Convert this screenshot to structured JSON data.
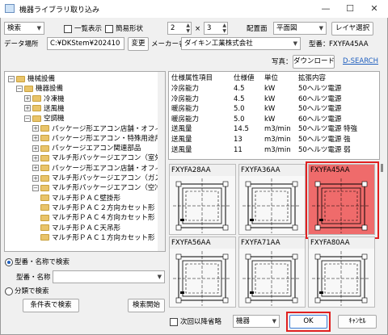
{
  "window": {
    "title": "機器ライブラリ取り込み",
    "minimize_glyph": "—",
    "maximize_glyph": "☐",
    "close_glyph": "✕"
  },
  "toolbar": {
    "search_mode": "検索",
    "list_view_label": "一覧表示",
    "simple_shape_label": "簡易形状",
    "cols_value": "2",
    "times_label": "×",
    "rows_value": "3",
    "layout_label": "配置面",
    "layout_value": "平面図",
    "layer_button": "レイヤ選択"
  },
  "datarow": {
    "data_location_label": "データ場所",
    "data_location_value": "C:¥DKStem¥202410",
    "change_button": "変更",
    "maker_label": "メーカー名",
    "maker_value": "ダイキン工業株式会社",
    "model_label": "型番：",
    "model_value": "FXYFA45AA"
  },
  "photo_row": {
    "photo_label": "写真：",
    "download_button": "ダウンロード",
    "dsearch_link": "D-SEARCH"
  },
  "tree": {
    "items": [
      {
        "indent": 0,
        "exp": "−",
        "icon": "folder",
        "label": "機械設備"
      },
      {
        "indent": 1,
        "exp": "−",
        "icon": "folder",
        "label": "機器設備"
      },
      {
        "indent": 2,
        "exp": "+",
        "icon": "folder",
        "label": "冷凍機"
      },
      {
        "indent": 2,
        "exp": "+",
        "icon": "folder",
        "label": "送風機"
      },
      {
        "indent": 2,
        "exp": "−",
        "icon": "folder",
        "label": "空調機"
      },
      {
        "indent": 3,
        "exp": "+",
        "icon": "folder",
        "label": "パッケージ形エアコン店舗・オフィス用（空"
      },
      {
        "indent": 3,
        "exp": "+",
        "icon": "folder",
        "label": "パッケージ形エアコン・特殊用途用"
      },
      {
        "indent": 3,
        "exp": "+",
        "icon": "folder",
        "label": "パッケージエアコン関連部品"
      },
      {
        "indent": 3,
        "exp": "+",
        "icon": "folder",
        "label": "マルチ形パッケージエアコン（室外機）"
      },
      {
        "indent": 3,
        "exp": "+",
        "icon": "folder",
        "label": "パッケージ形エアコン店舗・オフィス用（水"
      },
      {
        "indent": 3,
        "exp": "+",
        "icon": "folder",
        "label": "マルチ形パッケージエアコン（ガスＨＰ）"
      },
      {
        "indent": 3,
        "exp": "−",
        "icon": "folder",
        "label": "マルチ形パッケージエアコン（空冷ＨＰ）"
      },
      {
        "indent": 4,
        "exp": "",
        "icon": "folder",
        "label": "マルチ形ＰＡＣ壁掛形"
      },
      {
        "indent": 4,
        "exp": "",
        "icon": "folder",
        "label": "マルチ形ＰＡＣ２方向カセット形"
      },
      {
        "indent": 4,
        "exp": "",
        "icon": "folder",
        "label": "マルチ形ＰＡＣ４方向カセット形"
      },
      {
        "indent": 4,
        "exp": "",
        "icon": "folder",
        "label": "マルチ形ＰＡＣ天吊形"
      },
      {
        "indent": 4,
        "exp": "",
        "icon": "folder",
        "label": "マルチ形ＰＡＣ１方向カセット形"
      }
    ]
  },
  "search_panel": {
    "radio_name_label": "型番・名称で検索",
    "name_field_label": "型番・名称",
    "name_field_value": "",
    "radio_class_label": "分類で検索",
    "condition_button": "条件表で検索",
    "search_start_button": "検索開始"
  },
  "spec_table": {
    "headers": [
      "仕様属性項目",
      "仕様値",
      "単位",
      "拡張内容"
    ],
    "rows": [
      [
        "冷房能力",
        "4.5",
        "kW",
        "50ヘルツ電源"
      ],
      [
        "冷房能力",
        "4.5",
        "kW",
        "60ヘルツ電源"
      ],
      [
        "暖房能力",
        "5.0",
        "kW",
        "50ヘルツ電源"
      ],
      [
        "暖房能力",
        "5.0",
        "kW",
        "60ヘルツ電源"
      ],
      [
        "送風量",
        "14.5",
        "m3/min",
        "50ヘルツ電源 特強"
      ],
      [
        "送風量",
        "13",
        "m3/min",
        "50ヘルツ電源 強"
      ],
      [
        "送風量",
        "11",
        "m3/min",
        "50ヘルツ電源 弱"
      ]
    ]
  },
  "thumbnails": [
    {
      "label": "FXYFA28AA",
      "selected": false
    },
    {
      "label": "FXYFA36AA",
      "selected": false
    },
    {
      "label": "FXYFA45AA",
      "selected": true
    },
    {
      "label": "FXYFA56AA",
      "selected": false
    },
    {
      "label": "FXYFA71AA",
      "selected": false
    },
    {
      "label": "FXYFA80AA",
      "selected": false
    }
  ],
  "footer": {
    "later_omit_label": "次回以降省略",
    "category_value": "機器",
    "ok_button": "OK",
    "cancel_button": "ｷｬﾝｾﾙ"
  },
  "colors": {
    "highlight_red": "#e02020",
    "selected_fill": "#ef6b6b",
    "accent_blue": "#1f5fbf"
  }
}
